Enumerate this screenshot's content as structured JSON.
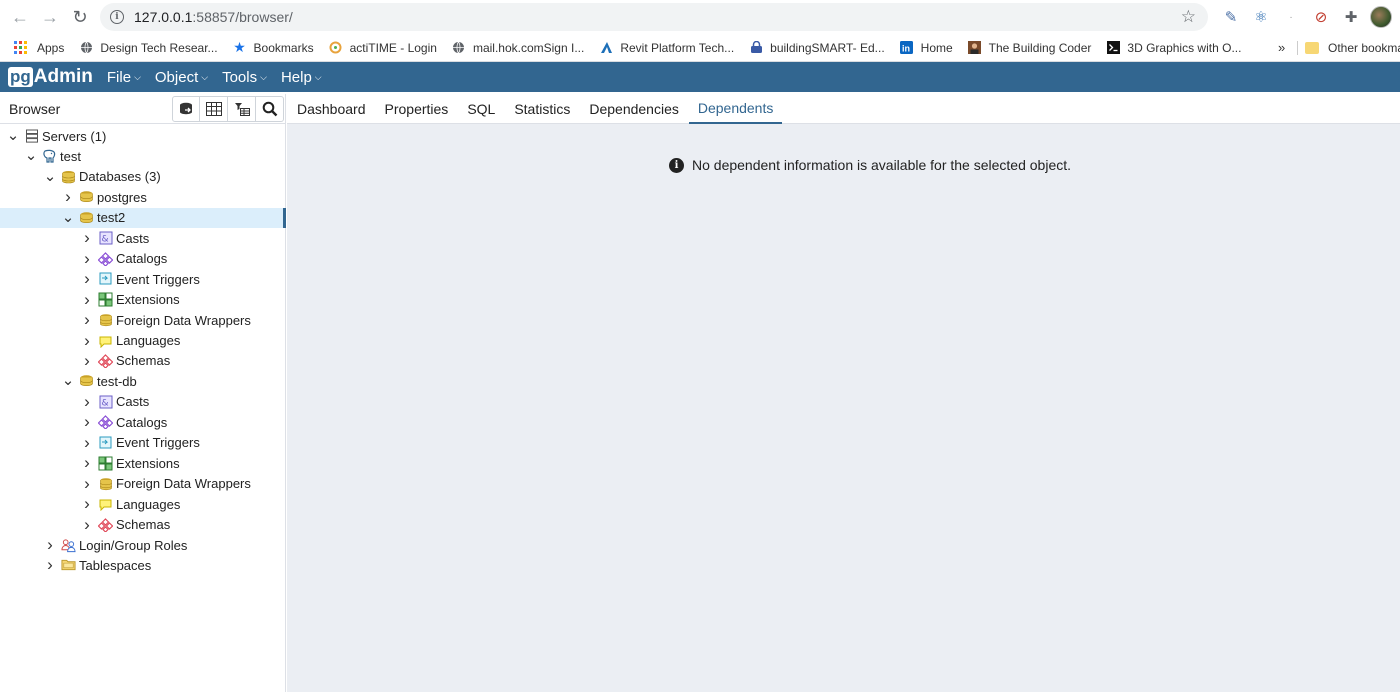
{
  "browser": {
    "url_host": "127.0.0.1",
    "url_rest": ":58857/browser/",
    "bookmarks": [
      {
        "label": "Apps",
        "icon": "apps-grid-icon"
      },
      {
        "label": "Design Tech Resear...",
        "icon": "globe-icon"
      },
      {
        "label": "Bookmarks",
        "icon": "star-icon"
      },
      {
        "label": "actiTIME - Login",
        "icon": "actitime-icon"
      },
      {
        "label": "mail.hok.comSign I...",
        "icon": "globe-icon"
      },
      {
        "label": "Revit Platform Tech...",
        "icon": "autodesk-icon"
      },
      {
        "label": "buildingSMART- Ed...",
        "icon": "lock-icon"
      },
      {
        "label": "Home",
        "icon": "linkedin-icon"
      },
      {
        "label": "The Building Coder",
        "icon": "person-icon"
      },
      {
        "label": "3D Graphics with O...",
        "icon": "terminal-icon"
      }
    ],
    "more_label": "»",
    "other_bookmarks": "Other bookma"
  },
  "app": {
    "logo_pg": "pg",
    "logo_admin": "Admin",
    "menu": [
      "File",
      "Object",
      "Tools",
      "Help"
    ]
  },
  "browser_panel": {
    "title": "Browser"
  },
  "tree": [
    {
      "label": "Servers (1)",
      "level": 0,
      "expanded": true,
      "icon": "servers-icon"
    },
    {
      "label": "test",
      "level": 1,
      "expanded": true,
      "icon": "elephant-icon"
    },
    {
      "label": "Databases (3)",
      "level": 2,
      "expanded": true,
      "icon": "databases-icon"
    },
    {
      "label": "postgres",
      "level": 3,
      "expanded": false,
      "icon": "database-icon"
    },
    {
      "label": "test2",
      "level": 3,
      "expanded": true,
      "icon": "database-icon",
      "selected": true
    },
    {
      "label": "Casts",
      "level": 4,
      "expanded": false,
      "icon": "casts-icon"
    },
    {
      "label": "Catalogs",
      "level": 4,
      "expanded": false,
      "icon": "catalogs-icon"
    },
    {
      "label": "Event Triggers",
      "level": 4,
      "expanded": false,
      "icon": "event-triggers-icon"
    },
    {
      "label": "Extensions",
      "level": 4,
      "expanded": false,
      "icon": "extensions-icon"
    },
    {
      "label": "Foreign Data Wrappers",
      "level": 4,
      "expanded": false,
      "icon": "fdw-icon"
    },
    {
      "label": "Languages",
      "level": 4,
      "expanded": false,
      "icon": "languages-icon"
    },
    {
      "label": "Schemas",
      "level": 4,
      "expanded": false,
      "icon": "schemas-icon"
    },
    {
      "label": "test-db",
      "level": 3,
      "expanded": true,
      "icon": "database-icon"
    },
    {
      "label": "Casts",
      "level": 4,
      "expanded": false,
      "icon": "casts-icon"
    },
    {
      "label": "Catalogs",
      "level": 4,
      "expanded": false,
      "icon": "catalogs-icon"
    },
    {
      "label": "Event Triggers",
      "level": 4,
      "expanded": false,
      "icon": "event-triggers-icon"
    },
    {
      "label": "Extensions",
      "level": 4,
      "expanded": false,
      "icon": "extensions-icon"
    },
    {
      "label": "Foreign Data Wrappers",
      "level": 4,
      "expanded": false,
      "icon": "fdw-icon"
    },
    {
      "label": "Languages",
      "level": 4,
      "expanded": false,
      "icon": "languages-icon"
    },
    {
      "label": "Schemas",
      "level": 4,
      "expanded": false,
      "icon": "schemas-icon"
    },
    {
      "label": "Login/Group Roles",
      "level": 2,
      "expanded": false,
      "icon": "roles-icon"
    },
    {
      "label": "Tablespaces",
      "level": 2,
      "expanded": false,
      "icon": "tablespaces-icon"
    }
  ],
  "tabs": [
    {
      "label": "Dashboard",
      "active": false
    },
    {
      "label": "Properties",
      "active": false
    },
    {
      "label": "SQL",
      "active": false
    },
    {
      "label": "Statistics",
      "active": false
    },
    {
      "label": "Dependencies",
      "active": false
    },
    {
      "label": "Dependents",
      "active": true
    }
  ],
  "message": "No dependent information is available for the selected object.",
  "colors": {
    "header": "#326690",
    "selected_row": "#dbeefb",
    "content_bg": "#ebeef3"
  }
}
